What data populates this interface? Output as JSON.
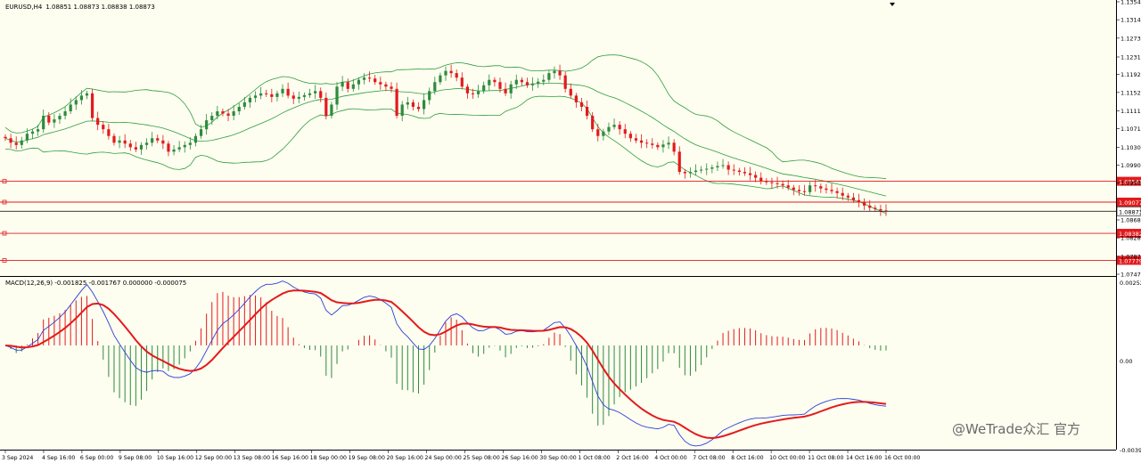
{
  "header": {
    "symbol_label": "EURUSD,H4",
    "ohlc_text": "1.08851 1.08873 1.08838 1.08873"
  },
  "macd": {
    "label": "MACD(12,26,9) -0.001825 -0.001767 0.000000 -0.000075",
    "zero_label": "0.00",
    "top_label": "0.002524",
    "bottom_label": "-0.00396"
  },
  "price_scale": [
    "1.13540",
    "1.13140",
    "1.12730",
    "1.12310",
    "1.11920",
    "1.11520",
    "1.11110",
    "1.10710",
    "1.10300",
    "1.09900",
    "1.09500",
    "1.08680",
    "1.08280",
    "1.07870",
    "1.07470"
  ],
  "horizontal_lines": [
    {
      "price": 1.09541,
      "label": "1.09541",
      "color": "#e31a1c"
    },
    {
      "price": 1.09077,
      "label": "1.09077",
      "color": "#e31a1c"
    },
    {
      "price": 1.08382,
      "label": "1.08382",
      "color": "#e31a1c"
    },
    {
      "price": 1.07779,
      "label": "1.07779",
      "color": "#e31a1c"
    }
  ],
  "current_price": {
    "price": 1.08873,
    "label": "1.08873",
    "color": "#000000"
  },
  "time_labels": [
    "3 Sep 2024",
    "4 Sep 16:00",
    "6 Sep 00:00",
    "9 Sep 08:00",
    "10 Sep 16:00",
    "12 Sep 00:00",
    "13 Sep 08:00",
    "16 Sep 16:00",
    "18 Sep 00:00",
    "19 Sep 08:00",
    "20 Sep 16:00",
    "24 Sep 00:00",
    "25 Sep 08:00",
    "26 Sep 16:00",
    "30 Sep 00:00",
    "1 Oct 08:00",
    "2 Oct 16:00",
    "4 Oct 00:00",
    "7 Oct 08:00",
    "8 Oct 16:00",
    "10 Oct 00:00",
    "11 Oct 08:00",
    "14 Oct 16:00",
    "16 Oct 00:00"
  ],
  "watermark": "@WeTrade众汇 官方",
  "colors": {
    "background": "#fdfdf0",
    "bull": "#2e8b3e",
    "bear": "#e31a1c",
    "bands": "#2e9e3e",
    "macd_line": "#2b3fd6",
    "signal_line": "#e31a1c"
  },
  "chart_data": {
    "type": "candlestick",
    "symbol": "EURUSD",
    "timeframe": "H4",
    "ylim": [
      1.0747,
      1.1354
    ],
    "closes": [
      1.105,
      1.104,
      1.1035,
      1.1045,
      1.106,
      1.1065,
      1.107,
      1.11,
      1.1085,
      1.1092,
      1.11,
      1.111,
      1.1125,
      1.1135,
      1.1145,
      1.115,
      1.1095,
      1.108,
      1.107,
      1.1055,
      1.104,
      1.1045,
      1.1038,
      1.103,
      1.1025,
      1.1035,
      1.104,
      1.105,
      1.1045,
      1.1038,
      1.102,
      1.1025,
      1.103,
      1.1035,
      1.104,
      1.1055,
      1.107,
      1.109,
      1.11,
      1.111,
      1.1105,
      1.11,
      1.111,
      1.112,
      1.113,
      1.114,
      1.1145,
      1.115,
      1.1148,
      1.1142,
      1.115,
      1.116,
      1.1145,
      1.1138,
      1.1142,
      1.1146,
      1.115,
      1.1155,
      1.114,
      1.11,
      1.1125,
      1.1165,
      1.1175,
      1.116,
      1.117,
      1.118,
      1.1185,
      1.1183,
      1.1175,
      1.117,
      1.1165,
      1.116,
      1.11,
      1.1125,
      1.113,
      1.112,
      1.1115,
      1.1135,
      1.1155,
      1.1175,
      1.119,
      1.12,
      1.1195,
      1.1185,
      1.1165,
      1.115,
      1.1148,
      1.1155,
      1.1168,
      1.118,
      1.1175,
      1.116,
      1.115,
      1.117,
      1.118,
      1.1175,
      1.1168,
      1.1172,
      1.1176,
      1.118,
      1.1195,
      1.12,
      1.119,
      1.116,
      1.1145,
      1.113,
      1.112,
      1.11,
      1.107,
      1.1055,
      1.1065,
      1.1075,
      1.108,
      1.107,
      1.106,
      1.105,
      1.1045,
      1.104,
      1.1038,
      1.1035,
      1.103,
      1.1036,
      1.104,
      1.102,
      1.0975,
      1.0972,
      1.0975,
      1.0978,
      1.098,
      1.0982,
      1.0985,
      1.0988,
      1.099,
      1.098,
      1.0978,
      1.0975,
      1.0972,
      1.0968,
      1.0962,
      1.0955,
      1.0952,
      1.095,
      1.0948,
      1.0945,
      1.094,
      1.0935,
      1.0932,
      1.093,
      1.0945,
      1.0943,
      1.0938,
      1.0935,
      1.0932,
      1.0928,
      1.0922,
      1.0918,
      1.0912,
      1.0908,
      1.09,
      1.0895,
      1.0892,
      1.0889,
      1.0887
    ]
  },
  "macd_data": {
    "ylim": [
      -0.00396,
      0.002524
    ],
    "zero": 0.0
  }
}
